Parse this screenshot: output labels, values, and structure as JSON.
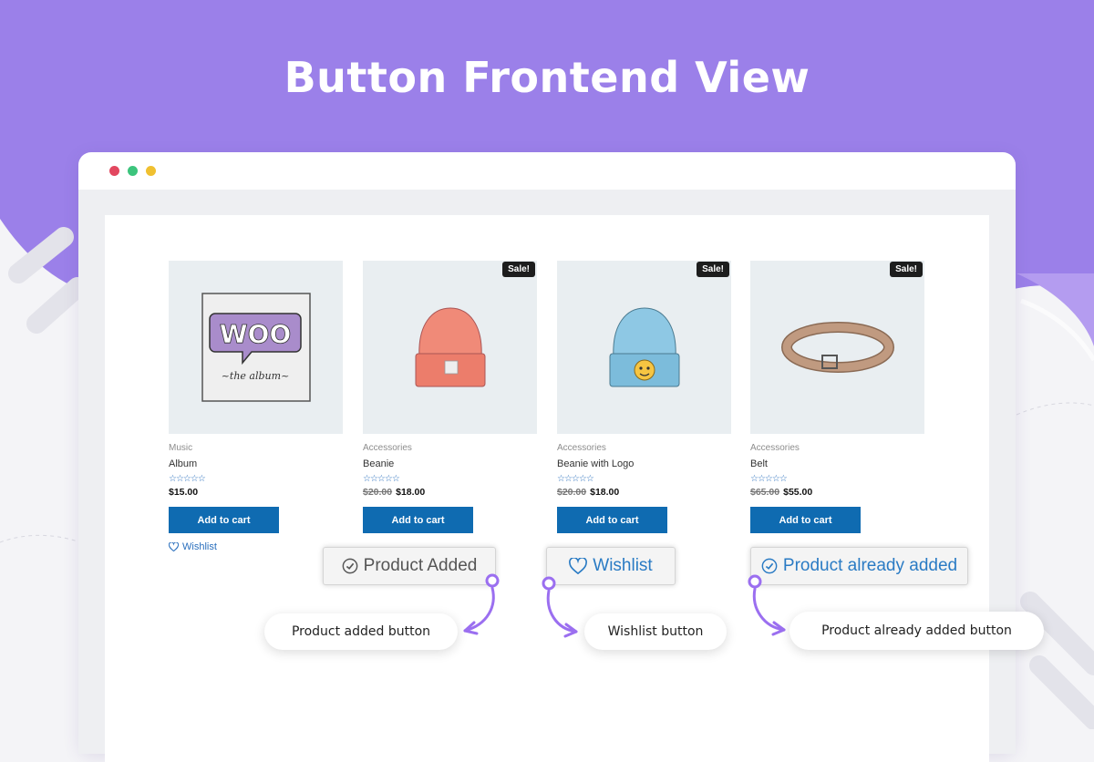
{
  "headline": "Button Frontend View",
  "colors": {
    "hero": "#9b80e9",
    "accent": "#9b6ff0",
    "button": "#0f6bb1",
    "dot_red": "#e2475f",
    "dot_green": "#3cc47c",
    "dot_yellow": "#f0c030"
  },
  "products": [
    {
      "category": "Music",
      "name": "Album",
      "stars": "☆☆☆☆☆",
      "old_price": "",
      "price": "$15.00",
      "sale": "",
      "button": "Add to cart",
      "image_icon": "woo-album-image"
    },
    {
      "category": "Accessories",
      "name": "Beanie",
      "stars": "☆☆☆☆☆",
      "old_price": "$20.00",
      "price": "$18.00",
      "sale": "Sale!",
      "button": "Add to cart",
      "image_icon": "beanie-image"
    },
    {
      "category": "Accessories",
      "name": "Beanie with Logo",
      "stars": "☆☆☆☆☆",
      "old_price": "$20.00",
      "price": "$18.00",
      "sale": "Sale!",
      "button": "Add to cart",
      "image_icon": "beanie-logo-image"
    },
    {
      "category": "Accessories",
      "name": "Belt",
      "stars": "☆☆☆☆☆",
      "old_price": "$65.00",
      "price": "$55.00",
      "sale": "Sale!",
      "button": "Add to cart",
      "image_icon": "belt-image"
    }
  ],
  "album_art": {
    "logo": "WOO",
    "caption": "~the album~"
  },
  "wishlist_link": "Wishlist",
  "zoom_buttons": {
    "product_added": "Product Added",
    "wishlist": "Wishlist",
    "already_added": "Product already added"
  },
  "callouts": {
    "product_added": "Product added button",
    "wishlist": "Wishlist button",
    "already_added": "Product already added button"
  }
}
